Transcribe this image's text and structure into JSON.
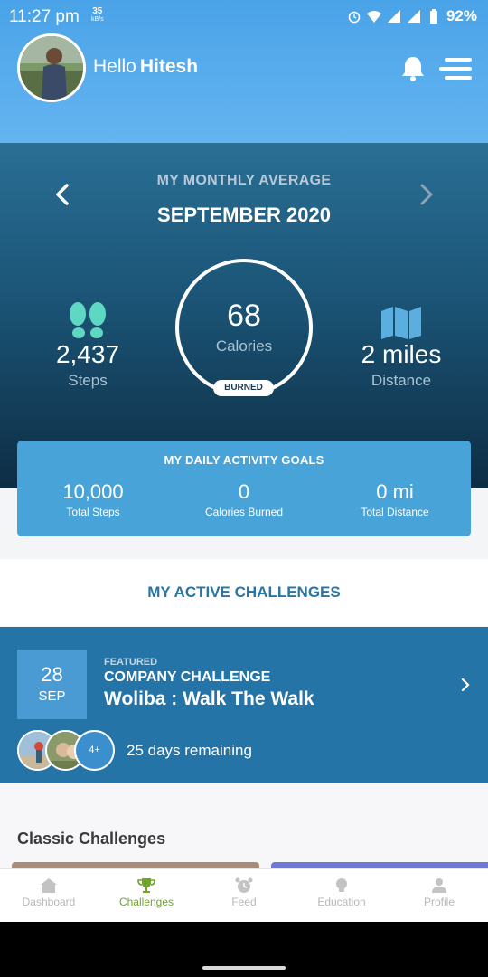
{
  "status_bar": {
    "time": "11:27 pm",
    "speed_value": "35",
    "speed_unit": "kB/s",
    "battery": "92%"
  },
  "header": {
    "greeting": "Hello",
    "user_name": "Hitesh"
  },
  "monthly": {
    "label": "MY MONTHLY AVERAGE",
    "title": "SEPTEMBER 2020",
    "calories_value": "68",
    "calories_label": "Calories",
    "burned_badge": "BURNED",
    "steps_value": "2,437",
    "steps_label": "Steps",
    "distance_value": "2 miles",
    "distance_label": "Distance"
  },
  "goals": {
    "title": "MY DAILY ACTIVITY GOALS",
    "items": [
      {
        "value": "10,000",
        "label": "Total Steps"
      },
      {
        "value": "0",
        "label": "Calories Burned"
      },
      {
        "value": "0 mi",
        "label": "Total Distance"
      }
    ]
  },
  "active_challenges": {
    "title": "MY ACTIVE CHALLENGES",
    "featured": {
      "day": "28",
      "month": "SEP",
      "tag": "FEATURED",
      "type": "COMPANY CHALLENGE",
      "name": "Woliba : Walk The Walk",
      "participants_more": "4+",
      "remaining": "25 days remaining"
    }
  },
  "classic": {
    "title": "Classic Challenges"
  },
  "bottom_nav": [
    {
      "label": "Dashboard",
      "icon": "home-icon"
    },
    {
      "label": "Challenges",
      "icon": "trophy-icon",
      "active": true
    },
    {
      "label": "Feed",
      "icon": "alarm-clock-icon"
    },
    {
      "label": "Education",
      "icon": "lightbulb-icon"
    },
    {
      "label": "Profile",
      "icon": "person-icon"
    }
  ],
  "colors": {
    "header_blue": "#4aa3e8",
    "panel_dark": "#1b5476",
    "goals_card": "#48a3d8",
    "challenge_card": "#2474a8",
    "nav_active": "#6ea52a"
  }
}
